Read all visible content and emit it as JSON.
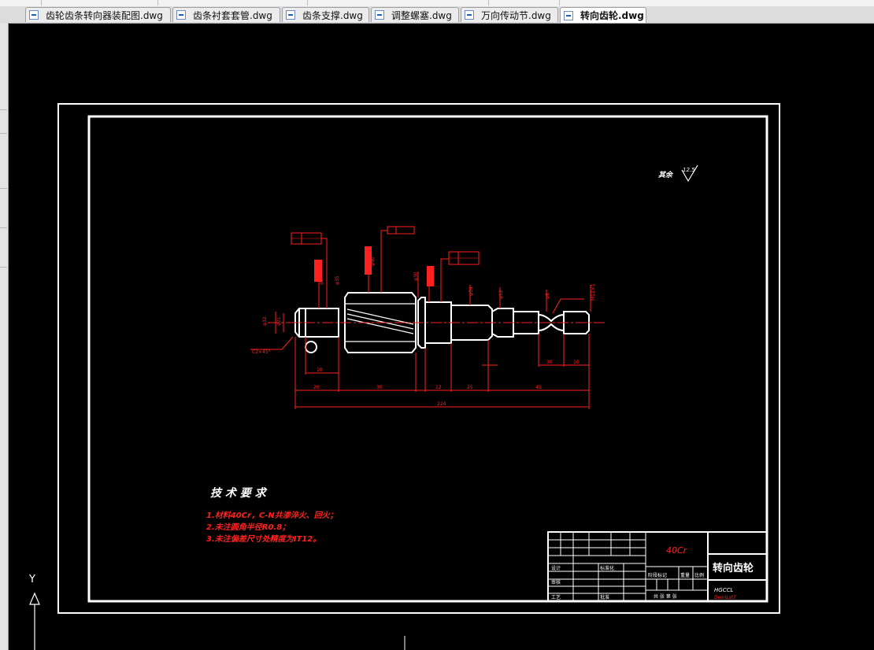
{
  "tabs": [
    {
      "label": "齿轮齿条转向器装配图.dwg",
      "active": false
    },
    {
      "label": "齿条衬套套管.dwg",
      "active": false
    },
    {
      "label": "齿条支撑.dwg",
      "active": false
    },
    {
      "label": "调整螺塞.dwg",
      "active": false
    },
    {
      "label": "万向传动节.dwg",
      "active": false
    },
    {
      "label": "转向齿轮.dwg",
      "active": true
    }
  ],
  "drawing": {
    "surface_note": "其余",
    "roughness": "12.5",
    "tech_title": "技 术 要 求",
    "tech_items": [
      "1.材料40Cr，C-N共渗淬火、回火；",
      "2.未注圆角半径R0.8；",
      "3.未注偏差尺寸处精度为IT12。"
    ],
    "chamfer_label": "C2×45°",
    "dims": {
      "d_left_outer": "φ32",
      "d_left_inner": "φ21",
      "d_gear_left": "φ25",
      "d_bearing": "φ35",
      "d_gear": "φ40",
      "d_shoulder": "φ30",
      "d_mid": "φ34",
      "d_neck": "φ12",
      "d_right": "φ8",
      "thread": "M12×1",
      "seg_a": "10",
      "seg_b": "20",
      "seg_c": "30",
      "seg_d": "12",
      "seg_e": "25",
      "seg_f": "45",
      "seg_g": "30",
      "seg_h": "10",
      "total": "224"
    },
    "title_block": {
      "material": "40Cr",
      "name": "转向齿轮",
      "code": "HGCCL",
      "scale_label": "比例",
      "weight_label": "重量",
      "stage_label": "阶段标记",
      "designer_label": "设计",
      "process_label": "工艺",
      "review_label": "审核",
      "sheet_label": "共 张 第 张",
      "standard_label": "标准化",
      "approve_label": "批准",
      "sub_code": "DesnLst7"
    }
  },
  "ucs": {
    "y": "Y"
  },
  "colors": {
    "background": "#000000",
    "border": "#ffffff",
    "annotation": "#ff2020"
  }
}
